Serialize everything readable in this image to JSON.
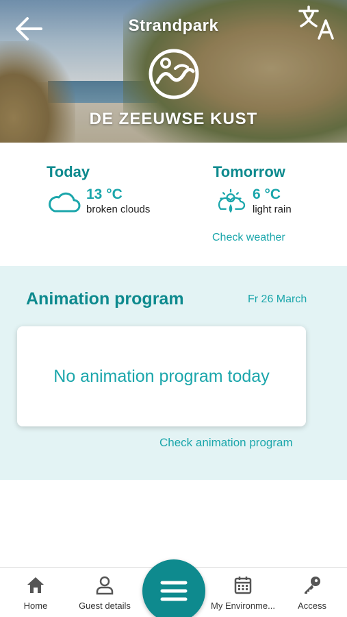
{
  "header": {
    "title": "Strandpark",
    "logo_text": "DE ZEEUWSE KUST",
    "back_icon": "arrow-left-icon",
    "translate_icon": "translate-icon"
  },
  "weather": {
    "today": {
      "heading": "Today",
      "temp": "13 °C",
      "description": "broken clouds",
      "icon": "cloud-icon"
    },
    "tomorrow": {
      "heading": "Tomorrow",
      "temp": "6 °C",
      "description": "light rain",
      "icon": "sun-cloud-rain-icon"
    },
    "check_link": "Check weather"
  },
  "animation": {
    "title": "Animation program",
    "date": "Fr 26 March",
    "empty_message": "No animation program today",
    "check_link": "Check animation program"
  },
  "nav": {
    "items": [
      {
        "label": "Home",
        "icon": "home-icon"
      },
      {
        "label": "Guest details",
        "icon": "user-icon"
      },
      {
        "label": "My Environme...",
        "icon": "calendar-icon"
      },
      {
        "label": "Access",
        "icon": "key-icon"
      }
    ],
    "menu_icon": "menu-icon"
  },
  "colors": {
    "accent": "#0e8a8e",
    "accent_light": "#1ba6ab",
    "section_bg": "#e3f3f4"
  }
}
